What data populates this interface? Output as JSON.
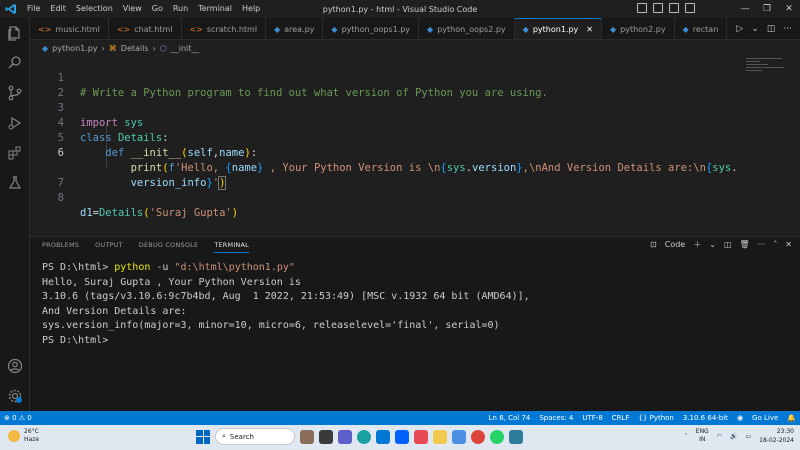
{
  "window": {
    "title": "python1.py - html - Visual Studio Code",
    "menu": [
      "File",
      "Edit",
      "Selection",
      "View",
      "Go",
      "Run",
      "Terminal",
      "Help"
    ]
  },
  "tabs": [
    {
      "label": "music.html",
      "icon": "html-icon",
      "color": "#e37933"
    },
    {
      "label": "chat.html",
      "icon": "html-icon",
      "color": "#e37933"
    },
    {
      "label": "scratch.html",
      "icon": "html-icon",
      "color": "#e37933"
    },
    {
      "label": "area.py",
      "icon": "python-icon",
      "color": "#3b8dd6"
    },
    {
      "label": "python_oops1.py",
      "icon": "python-icon",
      "color": "#3b8dd6"
    },
    {
      "label": "python_oops2.py",
      "icon": "python-icon",
      "color": "#3b8dd6"
    },
    {
      "label": "python1.py",
      "icon": "python-icon",
      "color": "#3b8dd6",
      "active": true
    },
    {
      "label": "python2.py",
      "icon": "python-icon",
      "color": "#3b8dd6"
    },
    {
      "label": "rectan",
      "icon": "python-icon",
      "color": "#3b8dd6"
    }
  ],
  "breadcrumb": {
    "file": "python1.py",
    "class": "Details",
    "method": "__init__"
  },
  "editor": {
    "line_numbers": [
      "1",
      "2",
      "3",
      "4",
      "5",
      "6",
      "",
      "7",
      "8"
    ],
    "comment": "# Write a Python program to find out what version of Python you are using."
  },
  "panel": {
    "tabs": [
      "PROBLEMS",
      "OUTPUT",
      "DEBUG CONSOLE",
      "TERMINAL"
    ],
    "active_tab": "TERMINAL",
    "shell_label": "Code",
    "terminal_lines": [
      "Hello, Suraj Gupta , Your Python Version is",
      "3.10.6 (tags/v3.10.6:9c7b4bd, Aug  1 2022, 21:53:49) [MSC v.1932 64 bit (AMD64)],",
      "And Version Details are:",
      "sys.version_info(major=3, minor=10, micro=6, releaselevel='final', serial=0)",
      "PS D:\\html>"
    ],
    "prompt": "PS D:\\html> ",
    "command": "python",
    "command_flag": "-u",
    "command_path": "\"d:\\html\\python1.py\""
  },
  "statusbar": {
    "problems": "⊗ 0 ⚠ 0",
    "position": "Ln 6, Col 74",
    "spaces": "Spaces: 4",
    "encoding": "UTF-8",
    "eol": "CRLF",
    "language": "{} Python",
    "interpreter": "3.10.6 64-bit",
    "golive": "Go Live"
  },
  "taskbar": {
    "temperature": "26°C",
    "weather": "Haze",
    "search_placeholder": "Search",
    "lang_top": "ENG",
    "lang_bottom": "IN",
    "time": "23:30",
    "date": "18-02-2024"
  },
  "colors": {
    "accent": "#0078d4",
    "editor_bg": "#1f1f1f",
    "statusbar": "#0078d4"
  }
}
